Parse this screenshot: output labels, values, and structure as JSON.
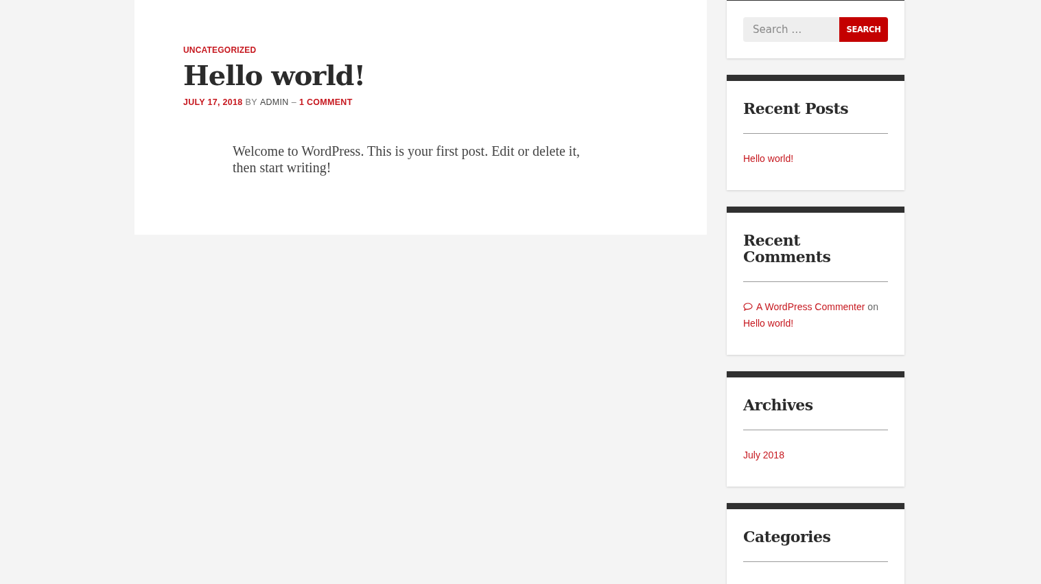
{
  "post": {
    "category": "UNCATEGORIZED",
    "title": "Hello world!",
    "meta": {
      "date": "JULY 17, 2018",
      "by": "BY",
      "author": "ADMIN",
      "separator": "–",
      "comments": "1 COMMENT"
    },
    "body": "Welcome to WordPress. This is your first post. Edit or delete it, then start writing!"
  },
  "sidebar": {
    "search": {
      "placeholder": "Search …",
      "button": "SEARCH"
    },
    "widgets": [
      {
        "kind": "links",
        "title": "Recent Posts",
        "links": [
          "Hello world!"
        ]
      },
      {
        "kind": "comments",
        "title": "Recent Comments",
        "comments": [
          {
            "author": "A WordPress Commenter",
            "on": "on",
            "post": "Hello world!"
          }
        ]
      },
      {
        "kind": "links",
        "title": "Archives",
        "links": [
          "July 2018"
        ]
      },
      {
        "kind": "links",
        "title": "Categories"
      }
    ]
  }
}
